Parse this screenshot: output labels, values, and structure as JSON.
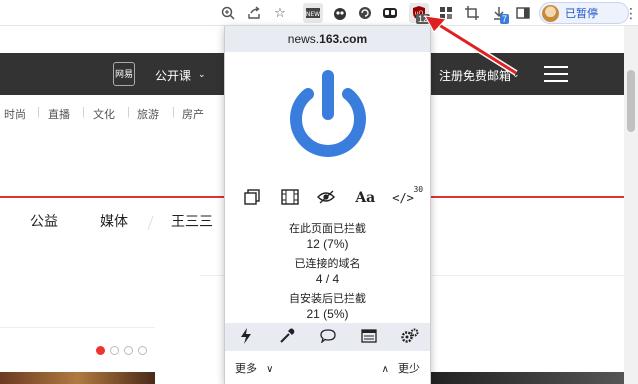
{
  "toolbar": {
    "zoom_icon": "zoom-icon",
    "share_icon": "share-icon",
    "star_icon": "star-icon",
    "ublock_badge": "12",
    "download_badge": "7",
    "pause_label": "已暂停",
    "more_icon": "⋮"
  },
  "page": {
    "nav_items": [
      "公开课",
      "注册免费邮箱"
    ],
    "nav_logo": "网易",
    "categories": [
      "时尚",
      "直播",
      "文化",
      "旅游",
      "房产"
    ],
    "section_links": [
      "公益",
      "媒体",
      "王三三"
    ]
  },
  "popup": {
    "domain_prefix": "news.",
    "domain_strong": "163.com",
    "tools": {
      "picker_label": "",
      "font_label": "Aa",
      "script_label": "</>",
      "script_count": "30"
    },
    "stats": {
      "blocked_page_label": "在此页面已拦截",
      "blocked_page_value": "12 (7%)",
      "domains_label": "已连接的域名",
      "domains_value": "4 / 4",
      "blocked_total_label": "自安装后已拦截",
      "blocked_total_value": "21 (5%)"
    },
    "footer": {
      "more_label": "更多",
      "less_label": "更少"
    }
  },
  "colors": {
    "power_blue": "#3b7ddd",
    "dark_nav": "#333333",
    "red_accent": "#dd3333",
    "popup_band": "#e9ebf3"
  }
}
